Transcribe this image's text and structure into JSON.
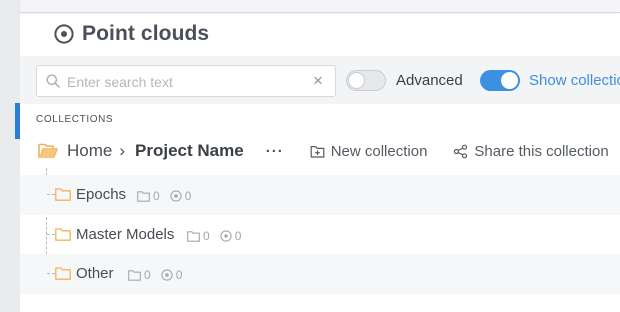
{
  "page": {
    "title": "Point clouds",
    "title_icon": "target-icon"
  },
  "toolbar": {
    "search_placeholder": "Enter search text",
    "clear_symbol": "×",
    "advanced_label": "Advanced",
    "advanced_on": false,
    "show_label": "Show collectio",
    "show_on": true
  },
  "section": {
    "label": "COLLECTIONS"
  },
  "breadcrumb": {
    "home": "Home",
    "separator": "›",
    "project": "Project Name",
    "more": "···"
  },
  "actions": {
    "new_collection": "New collection",
    "share": "Share this collection"
  },
  "collections": [
    {
      "name": "Epochs",
      "subcollections": "0",
      "pointclouds": "0"
    },
    {
      "name": "Master Models",
      "subcollections": "0",
      "pointclouds": "0"
    },
    {
      "name": "Other",
      "subcollections": "0",
      "pointclouds": "0"
    }
  ],
  "colors": {
    "accent": "#3d8fe0",
    "folder": "#f0b35a",
    "rail_active": "#2b7fd3"
  }
}
